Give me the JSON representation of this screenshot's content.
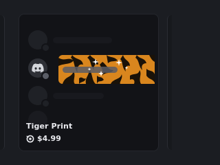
{
  "item": {
    "name": "Tiger Print",
    "price": "$4.99",
    "currency_icon": "orb-icon",
    "preview_effect": "tiger-stripes-with-sparkles"
  },
  "colors": {
    "background": "#1b1d22",
    "card": "#121317",
    "tiger_orange": "#d9861e",
    "tiger_stripe": "#1a1208",
    "text": "#e9eaee"
  }
}
